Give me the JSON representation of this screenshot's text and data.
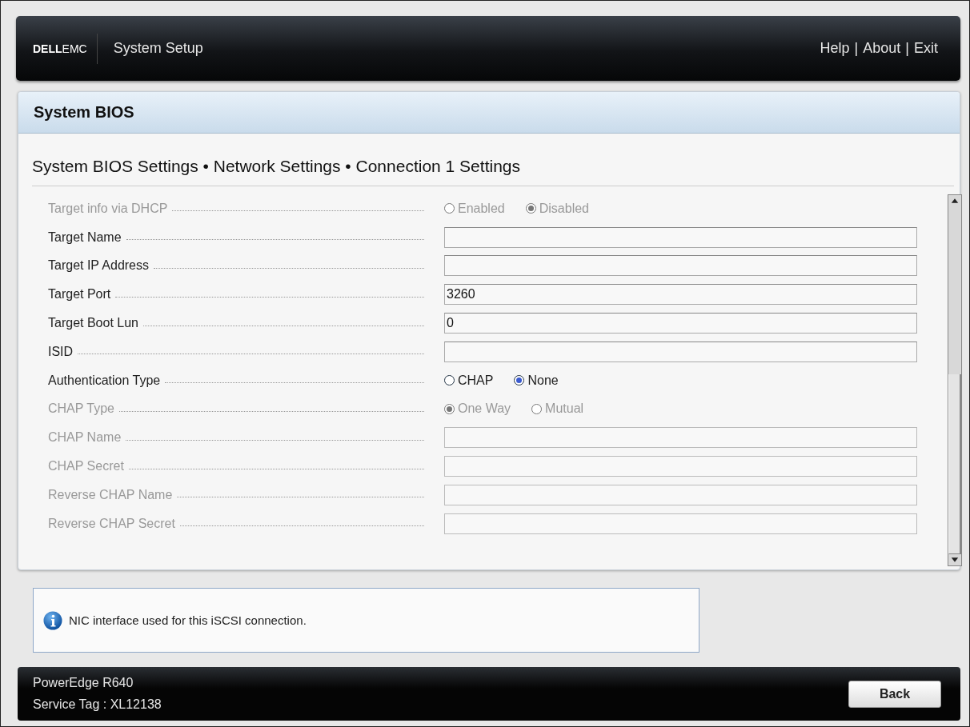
{
  "header": {
    "logo_bold": "DELL",
    "logo_light": "EMC",
    "title": "System Setup",
    "links": [
      "Help",
      "About",
      "Exit"
    ],
    "separator": "|"
  },
  "panel": {
    "title": "System BIOS",
    "breadcrumb": "System BIOS Settings • Network Settings • Connection 1 Settings"
  },
  "settings": [
    {
      "kind": "radio",
      "label": "Target info via DHCP",
      "disabled": true,
      "options": [
        {
          "label": "Enabled",
          "selected": false
        },
        {
          "label": "Disabled",
          "selected": true
        }
      ]
    },
    {
      "kind": "text",
      "label": "Target Name",
      "disabled": false
    },
    {
      "kind": "text",
      "label": "Target IP Address",
      "disabled": false
    },
    {
      "kind": "text",
      "label": "Target Port",
      "disabled": false,
      "value": "3260"
    },
    {
      "kind": "text",
      "label": "Target Boot Lun",
      "disabled": false,
      "value": "0"
    },
    {
      "kind": "text",
      "label": "ISID",
      "disabled": false
    },
    {
      "kind": "radio",
      "label": "Authentication Type",
      "disabled": false,
      "options": [
        {
          "label": "CHAP",
          "selected": false
        },
        {
          "label": "None",
          "selected": true
        }
      ]
    },
    {
      "kind": "radio",
      "label": "CHAP Type",
      "disabled": true,
      "options": [
        {
          "label": "One Way",
          "selected": true
        },
        {
          "label": "Mutual",
          "selected": false
        }
      ]
    },
    {
      "kind": "text",
      "label": "CHAP Name",
      "disabled": true
    },
    {
      "kind": "text",
      "label": "CHAP Secret",
      "disabled": true
    },
    {
      "kind": "text",
      "label": "Reverse CHAP Name",
      "disabled": true
    },
    {
      "kind": "text",
      "label": "Reverse CHAP Secret",
      "disabled": true
    }
  ],
  "info": {
    "text": "NIC interface used for this iSCSI connection."
  },
  "footer": {
    "model": "PowerEdge R640",
    "service_tag": "Service Tag : XL12138",
    "button": "Back"
  }
}
